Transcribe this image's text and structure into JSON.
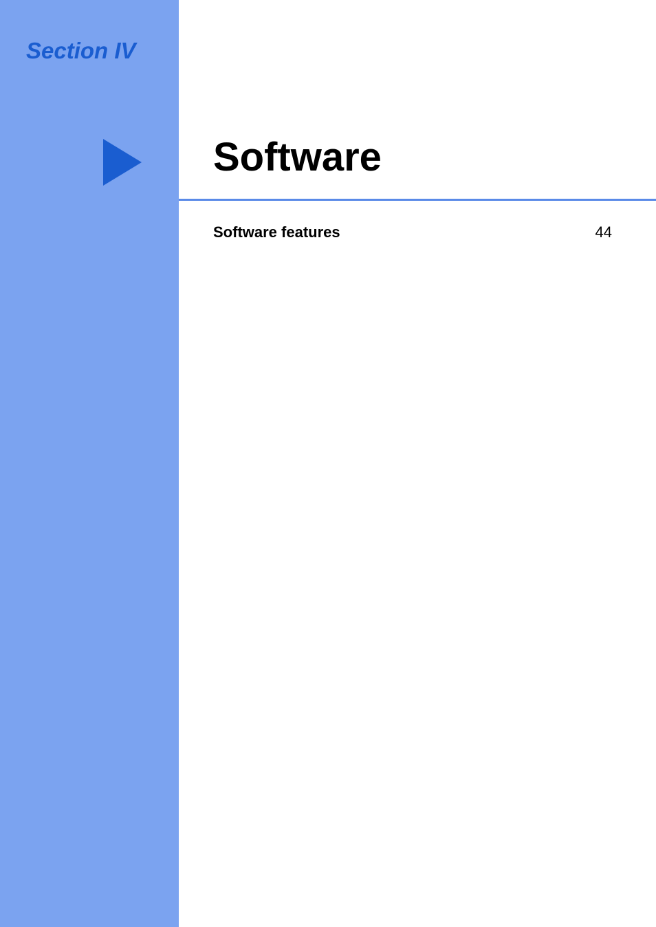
{
  "section": {
    "label": "Section IV"
  },
  "title": "Software",
  "toc": {
    "items": [
      {
        "label": "Software features",
        "page": "44"
      }
    ]
  }
}
